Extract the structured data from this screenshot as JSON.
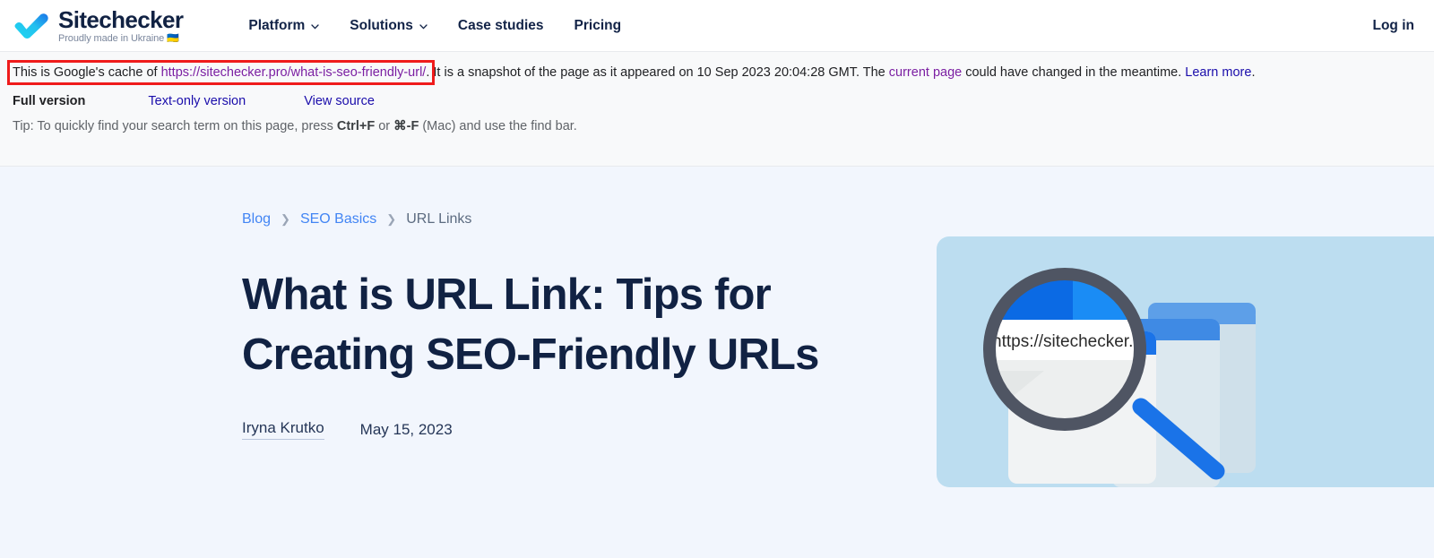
{
  "brand": {
    "name": "Sitechecker",
    "tagline": "Proudly made in Ukraine 🇺🇦",
    "logo_icon": "checkmark-logo-icon",
    "logo_gradient_from": "#22d3f0",
    "logo_gradient_to": "#1a73e8"
  },
  "header": {
    "nav": [
      {
        "label": "Platform",
        "has_dropdown": true,
        "icon": "chevron-down-icon"
      },
      {
        "label": "Solutions",
        "has_dropdown": true,
        "icon": "chevron-down-icon"
      },
      {
        "label": "Case studies",
        "has_dropdown": false
      },
      {
        "label": "Pricing",
        "has_dropdown": false
      }
    ],
    "login_label": "Log in"
  },
  "cache_banner": {
    "prefix": "This is Google's cache of ",
    "cached_url": "https://sitechecker.pro/what-is-seo-friendly-url/",
    "period": ".",
    "middle": " It is a snapshot of the page as it appeared on 10 Sep 2023 20:04:28 GMT. The ",
    "current_page_link": "current page",
    "after_current": " could have changed in the meantime. ",
    "learn_more_link": "Learn more",
    "end_period": ".",
    "snapshot_date": "10 Sep 2023 20:04:28 GMT",
    "highlight_box_color": "#ef1b1b",
    "versions": [
      {
        "label": "Full version",
        "active": true
      },
      {
        "label": "Text-only version",
        "active": false
      },
      {
        "label": "View source",
        "active": false
      }
    ],
    "tip_prefix": "Tip: To quickly find your search term on this page, press ",
    "tip_key1": "Ctrl+F",
    "tip_or": " or ",
    "tip_key2": "⌘-F",
    "tip_suffix": " (Mac) and use the find bar."
  },
  "article": {
    "breadcrumb": [
      {
        "label": "Blog",
        "is_link": true
      },
      {
        "label": "SEO Basics",
        "is_link": true
      },
      {
        "label": "URL Links",
        "is_link": false
      }
    ],
    "breadcrumb_separator": "❯",
    "title": "What is URL Link: Tips for Creating SEO-Friendly URLs",
    "author": "Iryna Krutko",
    "date": "May 15, 2023"
  },
  "hero": {
    "illustration_name": "magnifier-over-browser-windows-illustration",
    "lens_url_text": "https://sitechecker.pro",
    "panel_bg": "#bcddf0",
    "magnifier_rim": "#4f5563",
    "browser_bar_blue": "#1a73e8",
    "accent_blue": "#1a73e8"
  },
  "colors": {
    "page_bg": "#f2f6fd",
    "banner_bg": "#f8f9fa",
    "navy": "#112243",
    "link_blue": "#4285f4",
    "google_link": "#1a0dab",
    "google_visited": "#7b1fa2"
  }
}
